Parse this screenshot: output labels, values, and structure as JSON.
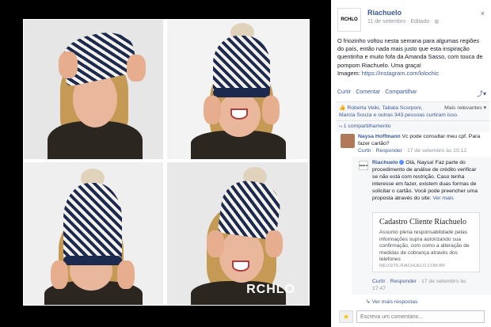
{
  "photo": {
    "watermark": "RCHLO"
  },
  "post": {
    "page_avatar_text": "RCHLO",
    "page_name": "Riachuelo",
    "date": "11 de setembro",
    "edited": "Editado",
    "close_icon": "close-icon",
    "caption_text": "O friozinho voltou nesta semana para algumas regiões do país, então nada mais justo que esta inspiração quentinha e muito fofa da Amanda Sasso, com touca de pompom Riachuelo. Uma graça!",
    "caption_prefix": "Imagem: ",
    "caption_link": "https://instagram.com/lolochic"
  },
  "actions": {
    "like": "Curtir",
    "comment": "Comentar",
    "share": "Compartilhar",
    "separator": " · "
  },
  "likes": {
    "line1": "Roberta Veiki, Tabata Scorponi,",
    "relevant": "Mais relevantes ▾",
    "line2": "Marcia Souza e outras 343 pessoas curtiram isso."
  },
  "shares": {
    "text": "1 compartilhamento"
  },
  "comments": [
    {
      "name": "Naysa Hoffmann",
      "text": "Vc pode consultar meu cpf. Para fazer cartão?",
      "like": "Curtir",
      "reply": "Responder",
      "time": "17 de setembro às 15:12"
    }
  ],
  "reply": {
    "avatar_text": "RCHLO",
    "name": "Riachuelo",
    "text": "Olá, Naysa! Faz parte do procedimento de análise de crédito verificar se não está com restrição. Caso tenha interesse em fazer, existem duas formas de solicitar o cartão. Você pode preencher uma proposta através do site:",
    "see_more": "Ver mais",
    "card": {
      "title": "Cadastro Cliente Riachuelo",
      "desc": "Assumo plena responsabilidade pelas informações supra autorizando sua confirmação, com como a alteração de medidas de cobrança através dos telefones",
      "url": "MEUSITE.RIACHUELO.COM.BR"
    },
    "like": "Curtir",
    "reply_label": "Responder",
    "time": "17 de setembro às 17:47"
  },
  "more_replies": "↳ Ver mais respostas",
  "write_comment": {
    "placeholder": "Escreva um comentário...",
    "avatar_icon": "user-avatar-icon"
  }
}
